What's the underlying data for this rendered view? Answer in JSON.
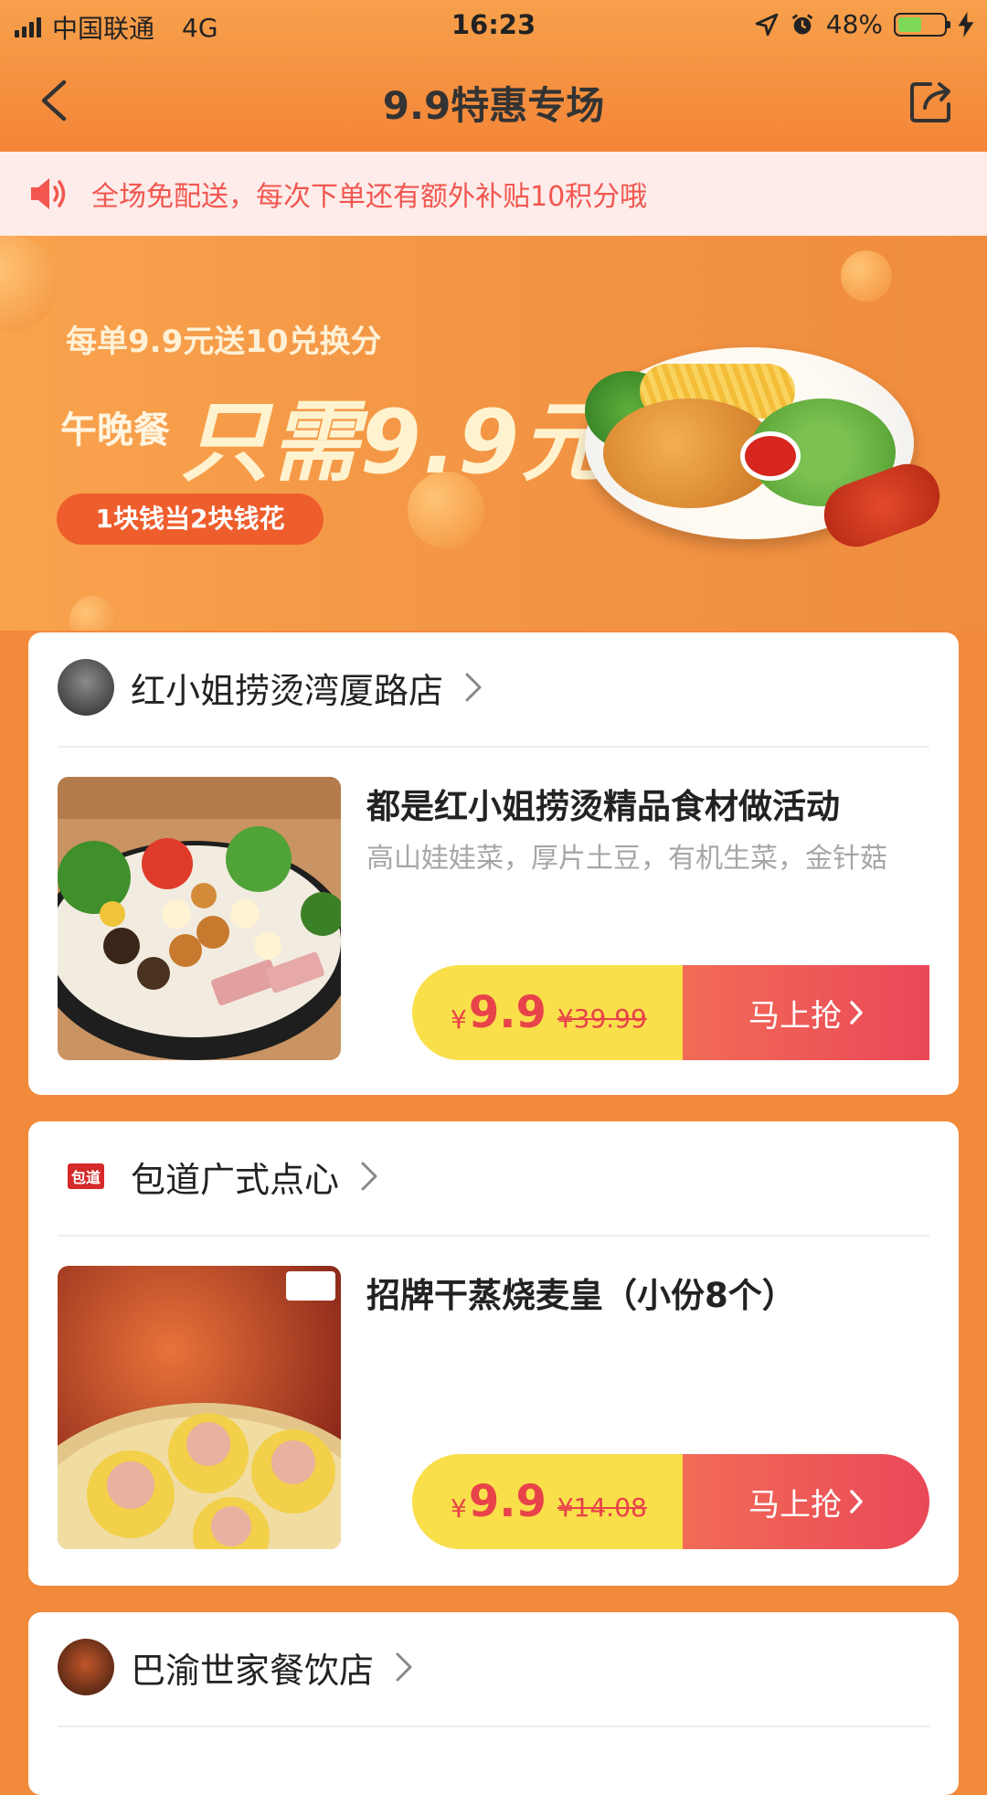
{
  "status_bar": {
    "carrier": "中国联通",
    "network": "4G",
    "time": "16:23",
    "battery": "48%",
    "battery_level": 0.48
  },
  "nav": {
    "title": "9.9特惠专场",
    "back_icon": "chevron-left-icon",
    "share_icon": "share-icon"
  },
  "notice": {
    "icon": "speaker-icon",
    "text": "全场免配送，每次下单还有额外补贴10积分哦"
  },
  "banner": {
    "line1": "每单9.9元送10兑换分",
    "line2_prefix": "午晚餐",
    "line2_main": "只需9.9元",
    "pill": "1块钱当2块钱花"
  },
  "shops": [
    {
      "name": "红小姐捞烫湾厦路店",
      "dish_title": "都是红小姐捞烫精品食材做活动",
      "dish_desc": "高山娃娃菜，厚片土豆，有机生菜，金针菇",
      "currency": "¥",
      "price": "9.9",
      "original_price": "¥39.99",
      "button_label": "马上抢"
    },
    {
      "name": "包道广式点心",
      "logo_text": "包道",
      "dish_title": "招牌干蒸烧麦皇（小份8个）",
      "dish_desc": "",
      "currency": "¥",
      "price": "9.9",
      "original_price": "¥14.08",
      "button_label": "马上抢"
    },
    {
      "name": "巴渝世家餐饮店"
    }
  ],
  "colors": {
    "accent": "#f38537",
    "price_red": "#e8424a",
    "price_yellow": "#f9df4a",
    "notice_bg": "#fdecea"
  }
}
